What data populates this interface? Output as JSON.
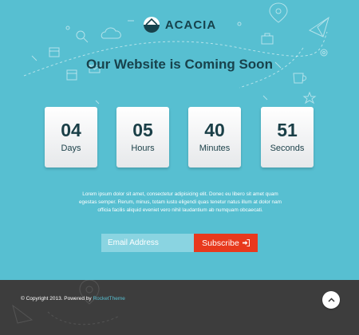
{
  "brand": {
    "name": "ACACIA"
  },
  "headline": "Our Website is Coming Soon",
  "countdown": [
    {
      "value": "04",
      "unit": "Days"
    },
    {
      "value": "05",
      "unit": "Hours"
    },
    {
      "value": "40",
      "unit": "Minutes"
    },
    {
      "value": "51",
      "unit": "Seconds"
    }
  ],
  "description": "Lorem ipsum dolor sit amet, consectetur adipisicing elit. Donec eu libero sit amet quam egestas semper. Rerum, minus, totam iusto eligendi quas tenetur natus illum at dolor nam officia facilis aliquid eveniet vero nihil laudantium ab numquam obcaecati.",
  "subscribe": {
    "placeholder": "Email Address",
    "button_label": "Subscribe"
  },
  "footer": {
    "copyright_prefix": "© Copyright 2013. Powered by ",
    "link_text": "RocketTheme"
  },
  "colors": {
    "hero_bg": "#57bfd1",
    "footer_bg": "#3d3d3d",
    "accent_red": "#e8391d",
    "dark_text": "#18424c"
  },
  "icons": [
    "logo-mark-icon",
    "sign-in-icon",
    "arrow-up-icon",
    "map-pin-icon",
    "paper-plane-icon",
    "cloud-icon",
    "search-icon",
    "gear-icon",
    "briefcase-icon",
    "calendar-icon",
    "coffee-cup-icon",
    "mail-icon",
    "star-icon"
  ]
}
